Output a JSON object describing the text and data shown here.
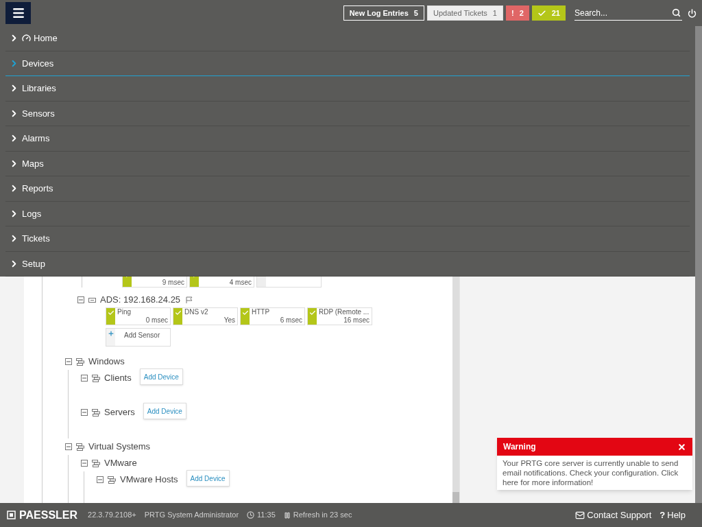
{
  "topbar": {
    "badges": [
      {
        "kind": "outline",
        "label": "New Log Entries",
        "count": "5"
      },
      {
        "kind": "light",
        "label": "Updated Tickets",
        "count": "1"
      },
      {
        "kind": "error",
        "label": "!",
        "count": "2"
      },
      {
        "kind": "ok",
        "count": "21"
      }
    ],
    "search": {
      "placeholder": "Search..."
    }
  },
  "menu": [
    {
      "label": "Home",
      "selected": false,
      "kind": "with_icon"
    },
    {
      "label": "Devices",
      "selected": true
    },
    {
      "label": "Libraries",
      "selected": false
    },
    {
      "label": "Sensors",
      "selected": false
    },
    {
      "label": "Alarms",
      "selected": false
    },
    {
      "label": "Maps",
      "selected": false
    },
    {
      "label": "Reports",
      "selected": false
    },
    {
      "label": "Logs",
      "selected": false
    },
    {
      "label": "Tickets",
      "selected": false
    },
    {
      "label": "Setup",
      "selected": false
    }
  ],
  "tree": {
    "partial_sensors": [
      {
        "kind": "ok",
        "value": "9 msec"
      },
      {
        "kind": "ok",
        "value": "4 msec"
      },
      {
        "kind": "empty"
      }
    ],
    "device": {
      "name": "ADS: 192.168.24.25",
      "expanded": true,
      "sensors": [
        {
          "kind": "ok",
          "name": "Ping",
          "value": "0 msec"
        },
        {
          "kind": "ok",
          "name": "DNS v2",
          "value": "Yes"
        },
        {
          "kind": "ok",
          "name": "HTTP",
          "value": "6 msec"
        },
        {
          "kind": "ok",
          "name": "RDP (Remote ...",
          "value": "16 msec"
        }
      ],
      "add_sensor": "Add Sensor"
    },
    "groups": [
      {
        "name": "Windows",
        "expanded": true,
        "children": [
          {
            "name": "Clients",
            "expanded": true,
            "add_device": "Add Device"
          },
          {
            "name": "Servers",
            "expanded": true,
            "add_device": "Add Device"
          }
        ]
      },
      {
        "name": "Virtual Systems",
        "expanded": true,
        "children": [
          {
            "name": "VMware",
            "expanded": true,
            "children": [
              {
                "name": "VMware Hosts",
                "expanded": true,
                "add_device": "Add Device"
              }
            ]
          }
        ]
      }
    ]
  },
  "warning": {
    "title": "Warning",
    "text": "Your PRTG core server is currently unable to send email notifications. Check your configuration. Click here for more information!"
  },
  "footer": {
    "brand": "PAESSLER",
    "version": "22.3.79.2108+",
    "user": "PRTG System Administrator",
    "time": "11:35",
    "refresh": "Refresh in 23 sec",
    "contact": "Contact Support",
    "help_icon": "?",
    "help": "Help"
  }
}
